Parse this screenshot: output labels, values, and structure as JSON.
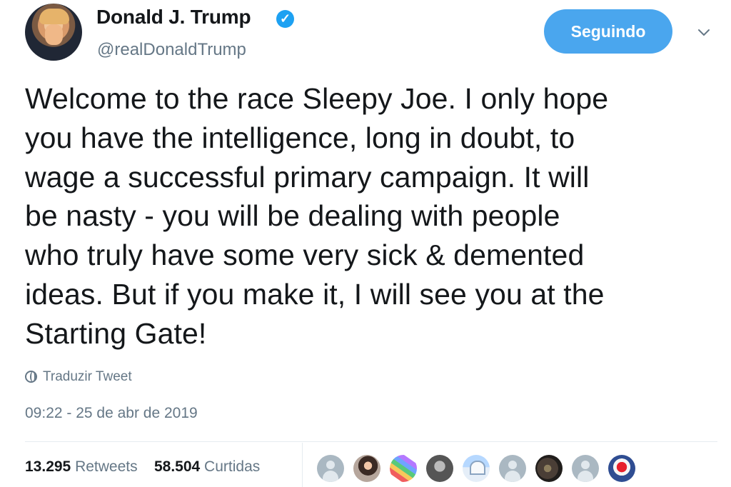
{
  "header": {
    "name": "Donald J. Trump",
    "handle": "@realDonaldTrump",
    "verified_mark": "✓",
    "follow_label": "Seguindo"
  },
  "tweet": {
    "text": "Welcome to the race Sleepy Joe. I only hope\nyou have the intelligence, long in doubt, to\nwage a successful primary campaign. It will\nbe nasty - you will be dealing with people\nwho truly have some very sick & demented\nideas. But if you make it, I will see you at the\nStarting Gate!",
    "translate_label": "Traduzir Tweet",
    "timestamp": "09:22 - 25 de abr de 2019"
  },
  "stats": {
    "retweets_count": "13.295",
    "retweets_label": "Retweets",
    "likes_count": "58.504",
    "likes_label": "Curtidas"
  },
  "icons": {
    "verified": "verified-badge-icon",
    "chevron": "chevron-down-icon",
    "translate": "globe-icon"
  },
  "colors": {
    "accent": "#1da1f2",
    "button": "#4aa6ee",
    "secondary_text": "#657786",
    "divider": "#e6ecf0"
  }
}
